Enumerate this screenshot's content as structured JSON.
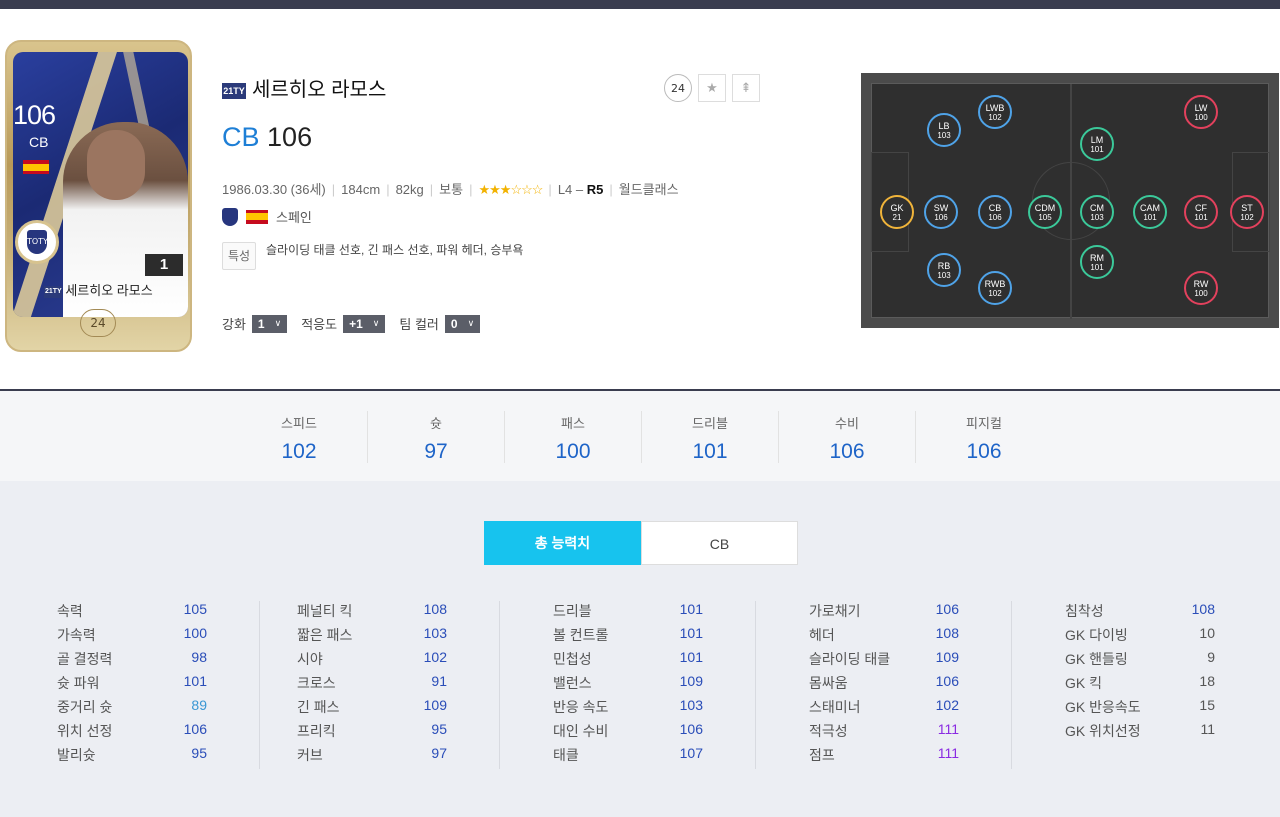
{
  "card": {
    "ovr": "106",
    "position": "CB",
    "level": "1",
    "season": "21TY",
    "name": "세르히오 라모스",
    "pay": "24",
    "club_emblem": "TOTY"
  },
  "player": {
    "season": "21TY",
    "name": "세르히오 라모스",
    "position": "CB",
    "ovr": "106",
    "birth": "1986.03.30 (36세)",
    "height": "184cm",
    "weight": "82kg",
    "body_type": "보통",
    "stars": "★★★☆☆☆",
    "league": "L4 – ",
    "league_bold": "R5",
    "rank": "월드클래스",
    "nation": "스페인",
    "traits_label": "특성",
    "traits": "슬라이딩 태클 선호, 긴 패스 선호, 파워 헤더, 승부욕"
  },
  "actions": {
    "pay": "24",
    "star_icon": "★",
    "upgrade_icon": "⇞"
  },
  "controls": {
    "enhance_label": "강화",
    "enhance_value": "1",
    "adapt_label": "적응도",
    "adapt_value": "+1",
    "team_color_label": "팀 컬러",
    "team_color_value": "0",
    "chevron": "∨"
  },
  "positions": [
    {
      "pos": "GK",
      "val": "21",
      "type": "gk"
    },
    {
      "pos": "SW",
      "val": "106",
      "type": "def"
    },
    {
      "pos": "LB",
      "val": "103",
      "type": "def"
    },
    {
      "pos": "RB",
      "val": "103",
      "type": "def"
    },
    {
      "pos": "LWB",
      "val": "102",
      "type": "def"
    },
    {
      "pos": "CB",
      "val": "106",
      "type": "def"
    },
    {
      "pos": "RWB",
      "val": "102",
      "type": "def"
    },
    {
      "pos": "CDM",
      "val": "105",
      "type": "mid"
    },
    {
      "pos": "LM",
      "val": "101",
      "type": "mid"
    },
    {
      "pos": "CM",
      "val": "103",
      "type": "mid"
    },
    {
      "pos": "RM",
      "val": "101",
      "type": "mid"
    },
    {
      "pos": "CAM",
      "val": "101",
      "type": "mid"
    },
    {
      "pos": "LW",
      "val": "100",
      "type": "att"
    },
    {
      "pos": "CF",
      "val": "101",
      "type": "att"
    },
    {
      "pos": "RW",
      "val": "100",
      "type": "att"
    },
    {
      "pos": "ST",
      "val": "102",
      "type": "att"
    }
  ],
  "summary": [
    {
      "label": "스피드",
      "value": "102"
    },
    {
      "label": "슛",
      "value": "97"
    },
    {
      "label": "패스",
      "value": "100"
    },
    {
      "label": "드리블",
      "value": "101"
    },
    {
      "label": "수비",
      "value": "106"
    },
    {
      "label": "피지컬",
      "value": "106"
    }
  ],
  "tabs": [
    "총 능력치",
    "CB"
  ],
  "stats": [
    [
      {
        "name": "속력",
        "value": "105"
      },
      {
        "name": "가속력",
        "value": "100"
      },
      {
        "name": "골 결정력",
        "value": "98"
      },
      {
        "name": "슛 파워",
        "value": "101"
      },
      {
        "name": "중거리 슛",
        "value": "89"
      },
      {
        "name": "위치 선정",
        "value": "106"
      },
      {
        "name": "발리슛",
        "value": "95"
      }
    ],
    [
      {
        "name": "페널티 킥",
        "value": "108"
      },
      {
        "name": "짧은 패스",
        "value": "103"
      },
      {
        "name": "시야",
        "value": "102"
      },
      {
        "name": "크로스",
        "value": "91"
      },
      {
        "name": "긴 패스",
        "value": "109"
      },
      {
        "name": "프리킥",
        "value": "95"
      },
      {
        "name": "커브",
        "value": "97"
      }
    ],
    [
      {
        "name": "드리블",
        "value": "101"
      },
      {
        "name": "볼 컨트롤",
        "value": "101"
      },
      {
        "name": "민첩성",
        "value": "101"
      },
      {
        "name": "밸런스",
        "value": "109"
      },
      {
        "name": "반응 속도",
        "value": "103"
      },
      {
        "name": "대인 수비",
        "value": "106"
      },
      {
        "name": "태클",
        "value": "107"
      }
    ],
    [
      {
        "name": "가로채기",
        "value": "106"
      },
      {
        "name": "헤더",
        "value": "108"
      },
      {
        "name": "슬라이딩 태클",
        "value": "109"
      },
      {
        "name": "몸싸움",
        "value": "106"
      },
      {
        "name": "스태미너",
        "value": "102"
      },
      {
        "name": "적극성",
        "value": "111"
      },
      {
        "name": "점프",
        "value": "111"
      }
    ],
    [
      {
        "name": "침착성",
        "value": "108"
      },
      {
        "name": "GK 다이빙",
        "value": "10"
      },
      {
        "name": "GK 핸들링",
        "value": "9"
      },
      {
        "name": "GK 킥",
        "value": "18"
      },
      {
        "name": "GK 반응속도",
        "value": "15"
      },
      {
        "name": "GK 위치선정",
        "value": "11"
      }
    ]
  ],
  "colors": {
    "accent": "#17c3ee",
    "stat_blue": "#2a4db8",
    "stat_purple": "#8a2be2",
    "def_ring": "#4fa3e8",
    "mid_ring": "#3bc99a",
    "att_ring": "#e3415d",
    "gk_ring": "#f0b43a"
  }
}
